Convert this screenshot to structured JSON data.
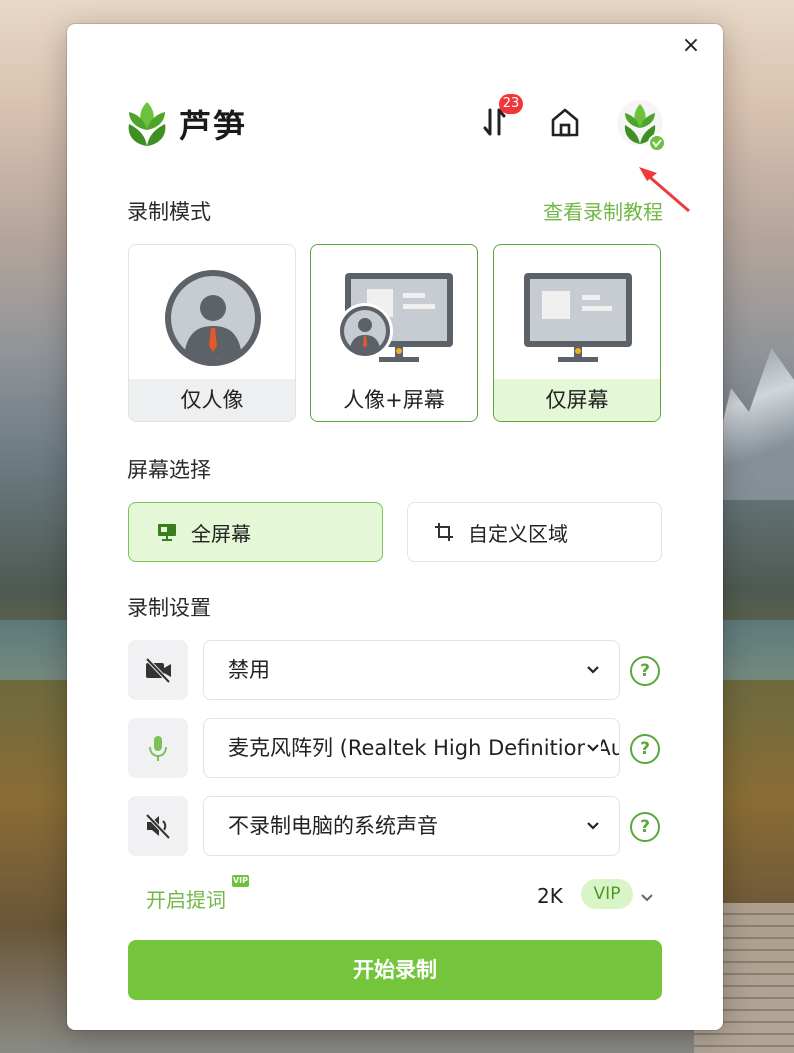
{
  "app": {
    "name": "芦笋",
    "close_label": "×",
    "sync_badge_count": "23",
    "brand_color": "#74c53b"
  },
  "record_mode": {
    "title": "录制模式",
    "tutorial_link": "查看录制教程",
    "options": [
      {
        "label": "仅人像",
        "icon": "person-avatar-icon",
        "selected": false
      },
      {
        "label": "人像+屏幕",
        "icon": "person-screen-icon",
        "selected": false
      },
      {
        "label": "仅屏幕",
        "icon": "monitor-icon",
        "selected": true
      }
    ]
  },
  "screen_select": {
    "title": "屏幕选择",
    "options": [
      {
        "label": "全屏幕",
        "icon": "monitor-small-icon",
        "selected": true
      },
      {
        "label": "自定义区域",
        "icon": "crop-icon",
        "selected": false
      }
    ]
  },
  "record_settings": {
    "title": "录制设置",
    "camera": {
      "value": "禁用",
      "icon": "camera-off-icon"
    },
    "microphone": {
      "value": "麦克风阵列 (Realtek High Definition Audio)",
      "icon": "microphone-icon"
    },
    "system_audio": {
      "value": "不录制电脑的系统声音",
      "icon": "speaker-off-icon"
    },
    "help_label": "?"
  },
  "footer": {
    "prompt_label": "开启提词",
    "prompt_vip_badge": "VIP",
    "resolution": "2K",
    "resolution_vip": "VIP",
    "start_button": "开始录制"
  }
}
